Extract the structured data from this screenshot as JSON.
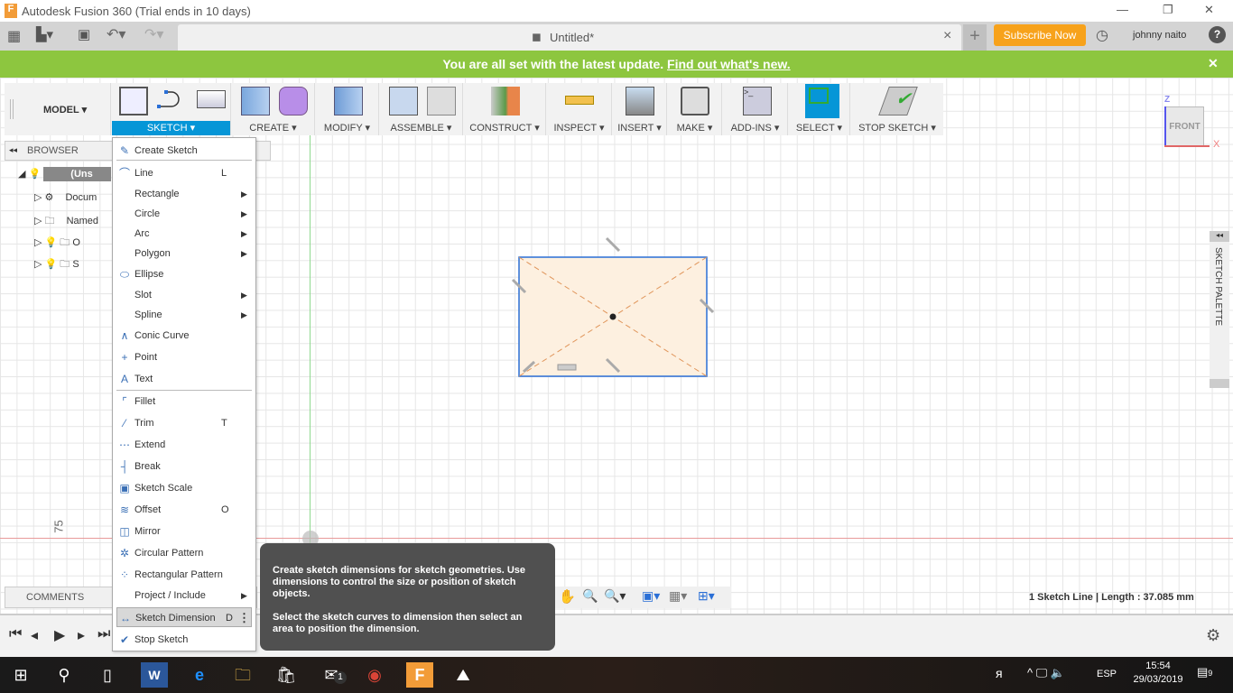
{
  "window": {
    "title": "Autodesk Fusion 360 (Trial ends in 10 days)",
    "min": "—",
    "max": "❐",
    "close": "✕"
  },
  "tabbar": {
    "doc_title": "Untitled*",
    "close": "×",
    "new_tab": "+",
    "subscribe": "Subscribe Now",
    "user": "johnny naito",
    "help": "?"
  },
  "banner": {
    "text": "You are all set with the latest update.",
    "link": "Find out what's new.",
    "close": "✕"
  },
  "toolbar": {
    "workspace": "MODEL ▾",
    "groups": [
      "SKETCH ▾",
      "CREATE ▾",
      "MODIFY ▾",
      "ASSEMBLE ▾",
      "CONSTRUCT ▾",
      "INSPECT ▾",
      "INSERT ▾",
      "MAKE ▾",
      "ADD-INS ▾",
      "SELECT ▾",
      "STOP SKETCH ▾"
    ]
  },
  "browser": {
    "title": "BROWSER",
    "items": [
      "(Uns",
      "Docum",
      "Named",
      "O",
      "S"
    ]
  },
  "sketch_menu": {
    "items": [
      {
        "label": "Create Sketch",
        "icon": "✎"
      },
      {
        "sep": true
      },
      {
        "label": "Line",
        "shortcut": "L",
        "icon": "⌒"
      },
      {
        "label": "Rectangle",
        "sub": true
      },
      {
        "label": "Circle",
        "sub": true
      },
      {
        "label": "Arc",
        "sub": true
      },
      {
        "label": "Polygon",
        "sub": true
      },
      {
        "label": "Ellipse",
        "icon": "⬭"
      },
      {
        "label": "Slot",
        "sub": true
      },
      {
        "label": "Spline",
        "sub": true
      },
      {
        "label": "Conic Curve",
        "icon": "∧"
      },
      {
        "label": "Point",
        "icon": "+"
      },
      {
        "label": "Text",
        "icon": "A"
      },
      {
        "sep": true
      },
      {
        "label": "Fillet",
        "icon": "⌜"
      },
      {
        "label": "Trim",
        "shortcut": "T",
        "icon": "⁄"
      },
      {
        "label": "Extend",
        "icon": "⋯"
      },
      {
        "label": "Break",
        "icon": "┤"
      },
      {
        "label": "Sketch Scale",
        "icon": "▣"
      },
      {
        "label": "Offset",
        "shortcut": "O",
        "icon": "≋"
      },
      {
        "label": "Mirror",
        "icon": "◫"
      },
      {
        "label": "Circular Pattern",
        "icon": "✲"
      },
      {
        "label": "Rectangular Pattern",
        "icon": "⁘"
      },
      {
        "label": "Project / Include",
        "sub": true
      },
      {
        "label": "Sketch Dimension",
        "shortcut": "D",
        "icon": "↔",
        "highlight": true,
        "more": "⋮"
      },
      {
        "label": "Stop Sketch",
        "icon": "✔"
      }
    ]
  },
  "tooltip": {
    "p1": "Create sketch dimensions for sketch geometries. Use dimensions to control the size or position of sketch objects.",
    "p2": "Select the sketch curves to dimension then select an area to position the dimension."
  },
  "viewcube": {
    "face": "FRONT",
    "z": "Z",
    "x": "X"
  },
  "palette": {
    "label": "SKETCH PALETTE"
  },
  "ruler": {
    "value": "75"
  },
  "comments": {
    "label": "COMMENTS"
  },
  "status": {
    "text": "1 Sketch Line | Length : 37.085 mm"
  },
  "taskbar": {
    "lang": "ESP",
    "time": "15:54",
    "date": "29/03/2019",
    "notifications": "9",
    "mail_badge": "1"
  },
  "colors": {
    "banner": "#8dc63f",
    "accent": "#0696d7",
    "subscribe": "#f7a21b"
  }
}
